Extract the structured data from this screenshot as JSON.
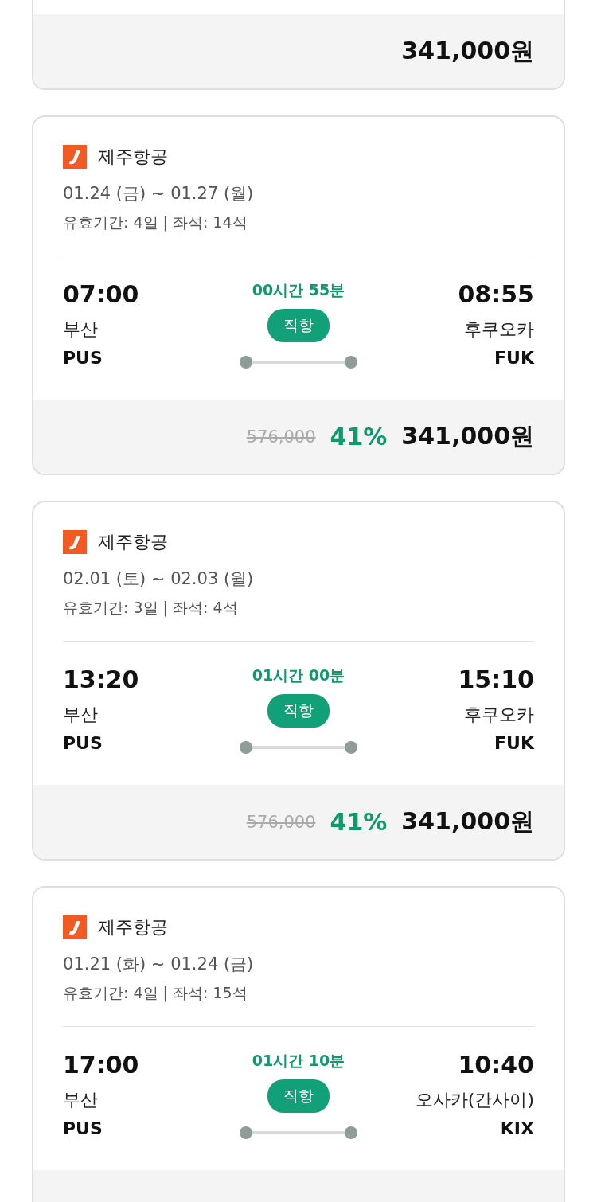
{
  "cards": [
    {
      "kind": "summary",
      "price": "341,000원"
    },
    {
      "kind": "flight",
      "airline": "제주항공",
      "dates": "01.24 (금) ~ 01.27 (월)",
      "validity": "유효기간: 4일 | 좌석: 14석",
      "depart_time": "07:00",
      "depart_city": "부산",
      "depart_code": "PUS",
      "duration": "00시간 55분",
      "badge": "직항",
      "arrive_time": "08:55",
      "arrive_city": "후쿠오카",
      "arrive_code": "FUK",
      "old_price": "576,000",
      "discount": "41%",
      "price": "341,000원"
    },
    {
      "kind": "flight",
      "airline": "제주항공",
      "dates": "02.01 (토) ~ 02.03 (월)",
      "validity": "유효기간: 3일 | 좌석: 4석",
      "depart_time": "13:20",
      "depart_city": "부산",
      "depart_code": "PUS",
      "duration": "01시간 00분",
      "badge": "직항",
      "arrive_time": "15:10",
      "arrive_city": "후쿠오카",
      "arrive_code": "FUK",
      "old_price": "576,000",
      "discount": "41%",
      "price": "341,000원"
    },
    {
      "kind": "flight",
      "airline": "제주항공",
      "dates": "01.21 (화) ~ 01.24 (금)",
      "validity": "유효기간: 4일 | 좌석: 15석",
      "depart_time": "17:00",
      "depart_city": "부산",
      "depart_code": "PUS",
      "duration": "01시간 10분",
      "badge": "직항",
      "arrive_time": "10:40",
      "arrive_city": "오사카(간사이)",
      "arrive_code": "KIX"
    }
  ]
}
